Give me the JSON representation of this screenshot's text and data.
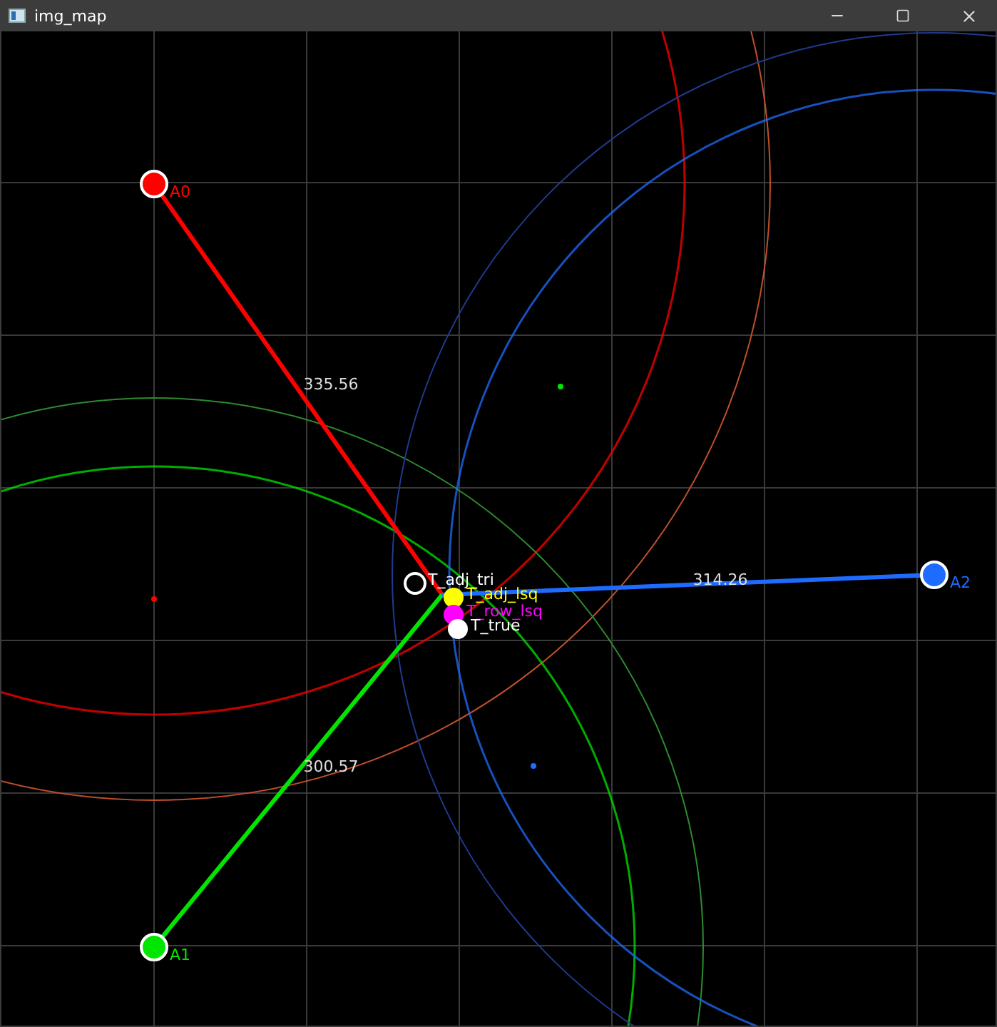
{
  "window": {
    "title": "img_map"
  },
  "anchors": [
    {
      "label": "A0",
      "color": "#ff0000",
      "distance": "335.56"
    },
    {
      "label": "A1",
      "color": "#00e600",
      "distance": "300.57"
    },
    {
      "label": "A2",
      "color": "#1e6cff",
      "distance": "314.26"
    }
  ],
  "estimates": [
    {
      "label": "T_adj_tri",
      "color": "#ffffff",
      "kind": "ring"
    },
    {
      "label": "T_adj_lsq",
      "color": "#ffff00",
      "kind": "filled"
    },
    {
      "label": "T_row_lsq",
      "color": "#ff00ff",
      "kind": "filled"
    },
    {
      "label": "T_true",
      "color": "#ffffff",
      "kind": "filled"
    }
  ]
}
